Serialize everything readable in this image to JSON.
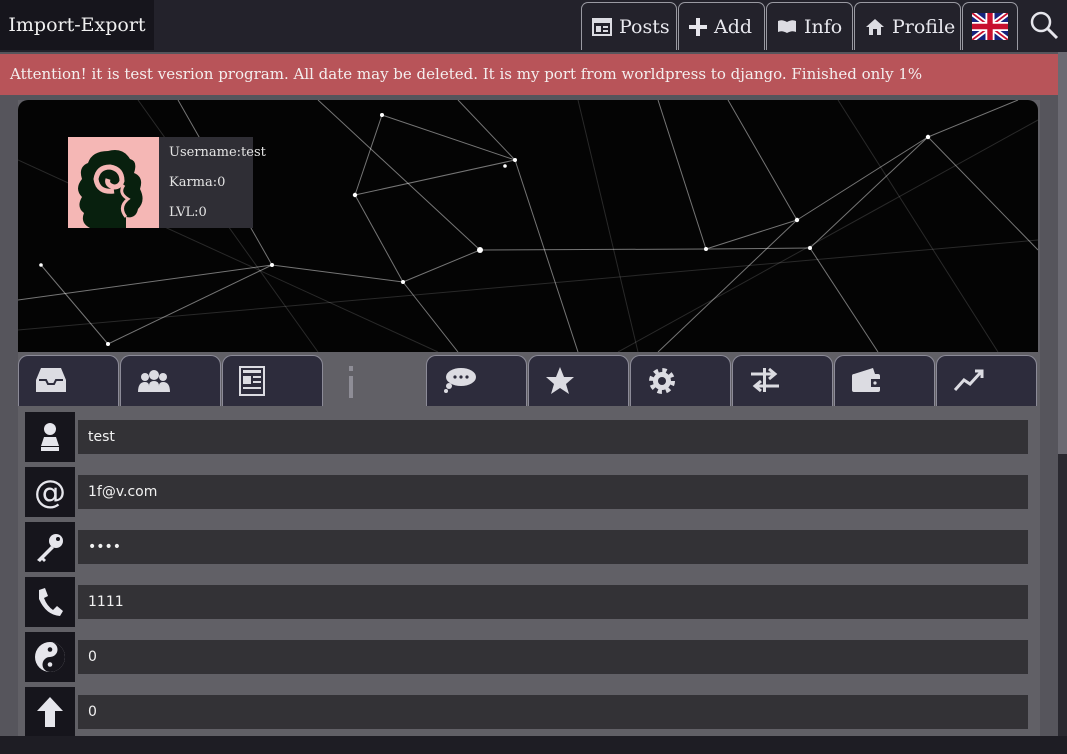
{
  "header": {
    "brand": "Import-Export",
    "nav": [
      {
        "label": "Posts",
        "icon": "newspaper-icon"
      },
      {
        "label": "Add",
        "icon": "plus-icon"
      },
      {
        "label": "Info",
        "icon": "book-icon"
      },
      {
        "label": "Profile",
        "icon": "home-icon"
      }
    ],
    "language_flag": "uk-flag-icon",
    "search_icon": "search-icon"
  },
  "alert": {
    "text": "Attention! it is test vesrion program. All date may be deleted. It is my port from worldpress to django. Finished only 1%",
    "color": "#b85459"
  },
  "profile": {
    "username": "Username:test",
    "karma": "Karma:0",
    "level": "LVL:0"
  },
  "tabs": [
    {
      "icon": "inbox-icon"
    },
    {
      "icon": "group-icon"
    },
    {
      "icon": "article-icon"
    },
    {
      "icon": "info-icon",
      "active": true
    },
    {
      "icon": "chat-icon"
    },
    {
      "icon": "star-icon"
    },
    {
      "icon": "gear-icon"
    },
    {
      "icon": "transfer-icon"
    },
    {
      "icon": "wallet-icon"
    },
    {
      "icon": "chart-icon"
    }
  ],
  "fields": [
    {
      "icon": "user-icon",
      "value": "test"
    },
    {
      "icon": "at-icon",
      "value": "1f@v.com"
    },
    {
      "icon": "key-icon",
      "value": "••••"
    },
    {
      "icon": "phone-icon",
      "value": "1111"
    },
    {
      "icon": "yin-yang-icon",
      "value": "0"
    },
    {
      "icon": "arrow-up-icon",
      "value": "0"
    }
  ]
}
